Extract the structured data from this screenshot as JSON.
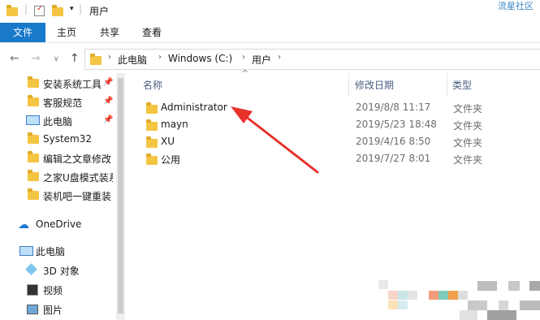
{
  "window": {
    "title": "用户"
  },
  "watermark": "流星社区",
  "ribbon": {
    "tabs": [
      "文件",
      "主页",
      "共享",
      "查看"
    ]
  },
  "address": {
    "path": [
      "此电脑",
      "Windows (C:)",
      "用户"
    ]
  },
  "nav_pane": {
    "quick_access": [
      {
        "label": "安装系统工具",
        "icon": "folder-icon",
        "pinned": true
      },
      {
        "label": "客服规范",
        "icon": "folder-icon",
        "pinned": true
      },
      {
        "label": "此电脑",
        "icon": "computer-icon",
        "pinned": true
      },
      {
        "label": "System32",
        "icon": "folder-icon",
        "pinned": false
      },
      {
        "label": "编辑之文章修改",
        "icon": "folder-icon",
        "pinned": false
      },
      {
        "label": "之家U盘模式装系统",
        "icon": "folder-icon",
        "pinned": false
      },
      {
        "label": "装机吧一键重装",
        "icon": "folder-icon",
        "pinned": false
      }
    ],
    "onedrive": "OneDrive",
    "this_pc": "此电脑",
    "pc_items": [
      {
        "label": "3D 对象",
        "icon": "3d-objects-icon"
      },
      {
        "label": "视频",
        "icon": "video-icon"
      },
      {
        "label": "图片",
        "icon": "pictures-icon"
      }
    ]
  },
  "columns": {
    "name": "名称",
    "modified": "修改日期",
    "type": "类型"
  },
  "files": [
    {
      "name": "Administrator",
      "modified": "2019/8/8 11:17",
      "type": "文件夹"
    },
    {
      "name": "mayn",
      "modified": "2019/5/23 18:48",
      "type": "文件夹"
    },
    {
      "name": "XU",
      "modified": "2019/4/16 8:50",
      "type": "文件夹"
    },
    {
      "name": "公用",
      "modified": "2019/7/27 8:01",
      "type": "文件夹"
    }
  ],
  "colors": {
    "accent": "#1979ca",
    "folder": "#f4c542",
    "arrow": "#e8322c"
  }
}
